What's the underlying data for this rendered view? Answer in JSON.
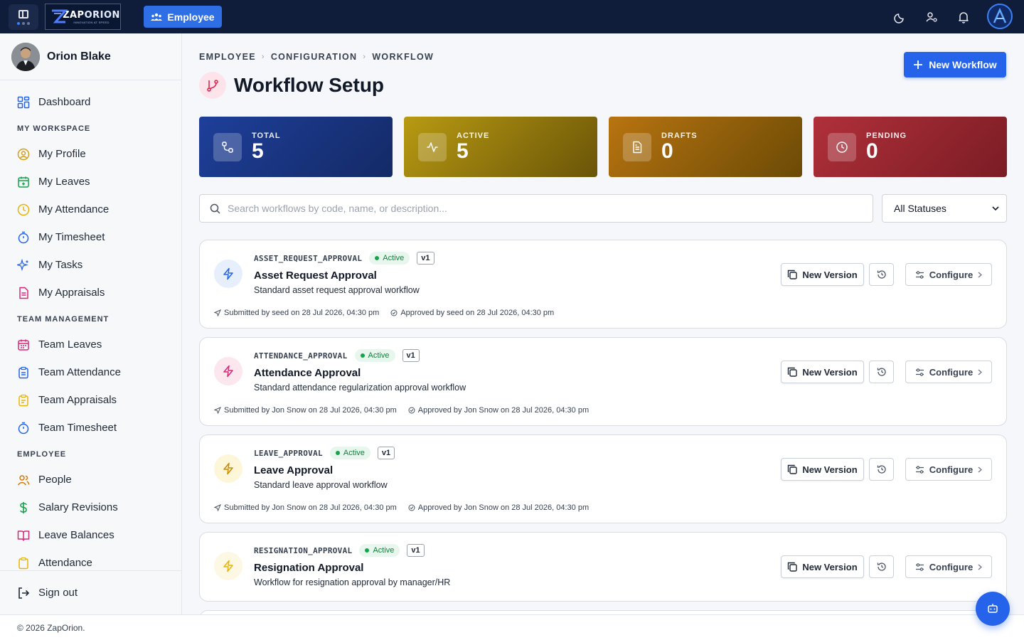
{
  "topbar": {
    "logo_name_1": "ZAP",
    "logo_name_2": "ORION",
    "logo_tagline": "INNOVATION AT SPEED",
    "module_label": "Employee"
  },
  "sidebar": {
    "user_name": "Orion Blake",
    "dashboard": "Dashboard",
    "sections": {
      "workspace": "MY WORKSPACE",
      "team": "TEAM MANAGEMENT",
      "employee": "EMPLOYEE"
    },
    "workspace_items": [
      "My Profile",
      "My Leaves",
      "My Attendance",
      "My Timesheet",
      "My Tasks",
      "My Appraisals"
    ],
    "team_items": [
      "Team Leaves",
      "Team Attendance",
      "Team Appraisals",
      "Team Timesheet"
    ],
    "employee_items": [
      "People",
      "Salary Revisions",
      "Leave Balances",
      "Attendance"
    ],
    "sign_out": "Sign out"
  },
  "breadcrumb": [
    "EMPLOYEE",
    "CONFIGURATION",
    "WORKFLOW"
  ],
  "page_title": "Workflow Setup",
  "new_workflow_label": "New Workflow",
  "stats": [
    {
      "label": "TOTAL",
      "value": "5"
    },
    {
      "label": "ACTIVE",
      "value": "5"
    },
    {
      "label": "DRAFTS",
      "value": "0"
    },
    {
      "label": "PENDING",
      "value": "0"
    }
  ],
  "search": {
    "placeholder": "Search workflows by code, name, or description...",
    "value": ""
  },
  "status_filter": "All Statuses",
  "card_actions": {
    "new_version": "New Version",
    "configure": "Configure"
  },
  "workflows": [
    {
      "code": "ASSET_REQUEST_APPROVAL",
      "status": "Active",
      "version": "v1",
      "name": "Asset Request Approval",
      "description": "Standard asset request approval workflow",
      "submitted": "Submitted by seed on 28 Jul 2026, 04:30 pm",
      "approved": "Approved by seed on 28 Jul 2026, 04:30 pm"
    },
    {
      "code": "ATTENDANCE_APPROVAL",
      "status": "Active",
      "version": "v1",
      "name": "Attendance Approval",
      "description": "Standard attendance regularization approval workflow",
      "submitted": "Submitted by Jon Snow on 28 Jul 2026, 04:30 pm",
      "approved": "Approved by Jon Snow on 28 Jul 2026, 04:30 pm"
    },
    {
      "code": "LEAVE_APPROVAL",
      "status": "Active",
      "version": "v1",
      "name": "Leave Approval",
      "description": "Standard leave approval workflow",
      "submitted": "Submitted by Jon Snow on 28 Jul 2026, 04:30 pm",
      "approved": "Approved by Jon Snow on 28 Jul 2026, 04:30 pm"
    },
    {
      "code": "RESIGNATION_APPROVAL",
      "status": "Active",
      "version": "v1",
      "name": "Resignation Approval",
      "description": "Workflow for resignation approval by manager/HR"
    }
  ],
  "footer": "© 2026 ZapOrion.",
  "colors": {
    "topbar": "#0f1d3a",
    "primary": "#2563eb",
    "active_badge": "#16a34a"
  }
}
